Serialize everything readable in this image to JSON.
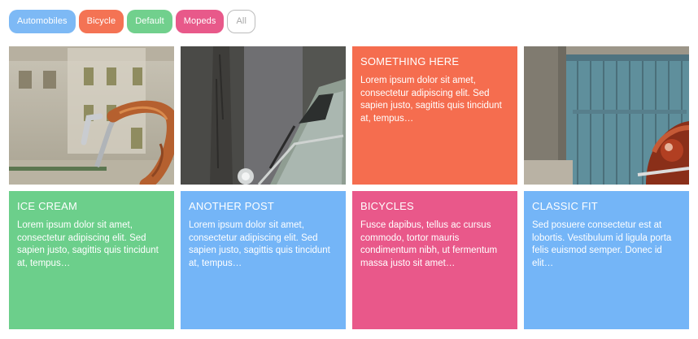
{
  "filters": [
    {
      "label": "Automobiles",
      "color": "#7db9f5"
    },
    {
      "label": "Bicycle",
      "color": "#f47354"
    },
    {
      "label": "Default",
      "color": "#71d08d"
    },
    {
      "label": "Mopeds",
      "color": "#e8598a"
    },
    {
      "label": "All",
      "color": "#ffffff"
    }
  ],
  "cards": {
    "something_here": {
      "title": "SOMETHING HERE",
      "text": "Lorem ipsum dolor sit amet, consectetur adipiscing elit. Sed sapien justo, sagittis quis tincidunt at, tempus…",
      "color": "#f56d4f"
    },
    "ice_cream": {
      "title": "ICE CREAM",
      "text": "Lorem ipsum dolor sit amet, consectetur adipiscing elit. Sed sapien justo, sagittis quis tincidunt at, tempus…",
      "color": "#6ccf8b"
    },
    "another_post": {
      "title": "ANOTHER POST",
      "text": "Lorem ipsum dolor sit amet, consectetur adipiscing elit. Sed sapien justo, sagittis quis tincidunt at, tempus…",
      "color": "#74b5f7"
    },
    "bicycles": {
      "title": "BICYCLES",
      "text": "Fusce dapibus, tellus ac cursus commodo, tortor mauris condimentum nibh, ut fermentum massa justo sit amet…",
      "color": "#e9588a"
    },
    "classic_fit": {
      "title": "CLASSIC FIT",
      "text": "Sed posuere consectetur est at lobortis. Vestibulum id ligula porta felis euismod semper. Donec id elit…",
      "color": "#74b5f7"
    }
  },
  "photos": [
    {
      "icon": "bicycle-handlebar-photo"
    },
    {
      "icon": "car-windshield-photo"
    },
    {
      "icon": "blue-door-moped-photo"
    }
  ]
}
